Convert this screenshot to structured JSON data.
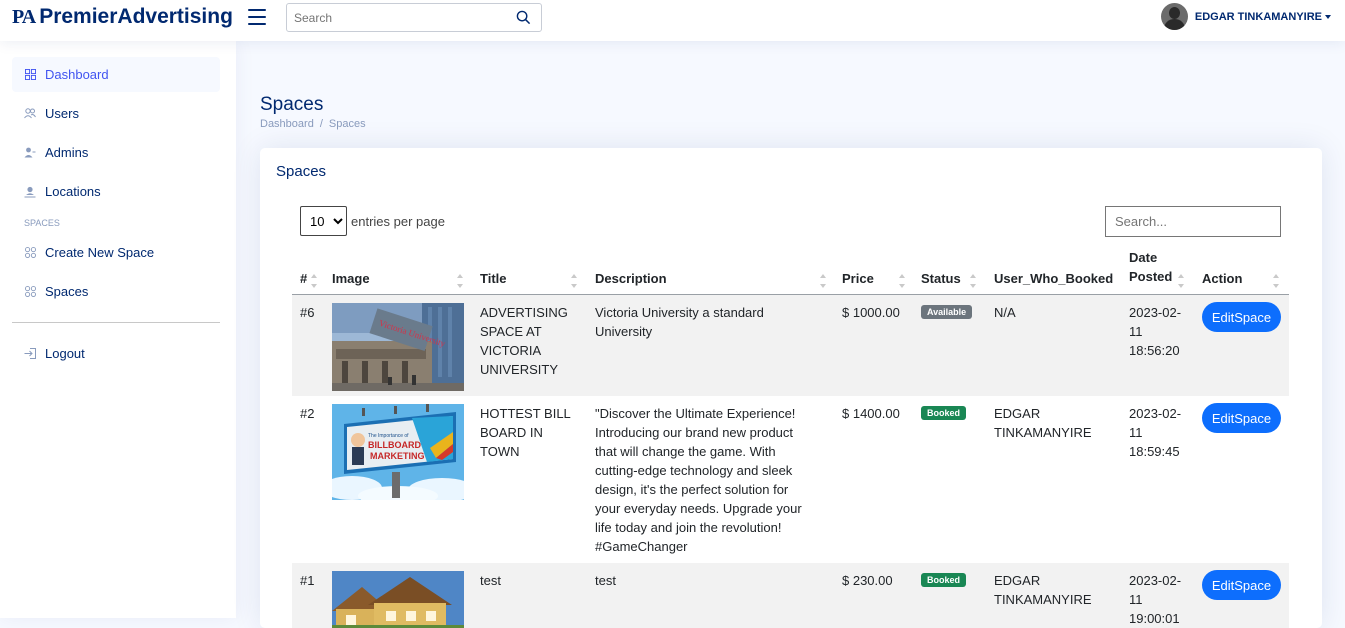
{
  "header": {
    "logo_mark": "PA",
    "logo_text": "PremierAdvertising",
    "search_placeholder": "Search",
    "profile_name": "EDGAR TINKAMANYIRE"
  },
  "sidebar": {
    "items": [
      {
        "label": "Dashboard",
        "icon": "grid-icon"
      },
      {
        "label": "Users",
        "icon": "people-icon"
      },
      {
        "label": "Admins",
        "icon": "person-gear-icon"
      },
      {
        "label": "Locations",
        "icon": "person-pin-icon"
      },
      {
        "label": "Create New Space",
        "icon": "grid-icon"
      },
      {
        "label": "Spaces",
        "icon": "grid-icon"
      },
      {
        "label": "Logout",
        "icon": "logout-icon"
      }
    ],
    "heading": "SPACES"
  },
  "main": {
    "page_title": "Spaces",
    "breadcrumb": [
      "Dashboard",
      "/",
      "Spaces"
    ],
    "card_title": "Spaces",
    "per_page_value": "10",
    "per_page_label": "entries per page",
    "table_search_placeholder": "Search...",
    "columns": [
      "#",
      "Image",
      "Title",
      "Description",
      "Price",
      "Status",
      "User_Who_Booked",
      "Date Posted",
      "Action"
    ],
    "rows": [
      {
        "id": "#6",
        "image": "victoria-university-photo",
        "title": "ADVERTISING SPACE AT VICTORIA UNIVERSITY",
        "description": "Victoria University a standard University",
        "price": "$ 1000.00",
        "status": "Available",
        "user": "N/A",
        "date": "2023-02-11 18:56:20",
        "action": "EditSpace"
      },
      {
        "id": "#2",
        "image": "billboard-marketing-photo",
        "title": "HOTTEST BILL BOARD IN TOWN",
        "description": "\"Discover the Ultimate Experience! Introducing our brand new product that will change the game. With cutting-edge technology and sleek design, it's the perfect solution for your everyday needs. Upgrade your life today and join the revolution! #GameChanger",
        "price": "$ 1400.00",
        "status": "Booked",
        "user": "EDGAR TINKAMANYIRE",
        "date": "2023-02-11 18:59:45",
        "action": "EditSpace"
      },
      {
        "id": "#1",
        "image": "house-photo",
        "title": "test",
        "description": "test",
        "price": "$ 230.00",
        "status": "Booked",
        "user": "EDGAR TINKAMANYIRE",
        "date": "2023-02-11 19:00:01",
        "action": "EditSpace"
      }
    ]
  },
  "billboard_text": [
    "The Importance of",
    "BILLBOARD",
    "MARKETING"
  ],
  "building_sign": "Victoria University",
  "colors": {
    "primary": "#0d6efd",
    "navy": "#012970",
    "booked": "#198754",
    "available": "#6c757d"
  }
}
